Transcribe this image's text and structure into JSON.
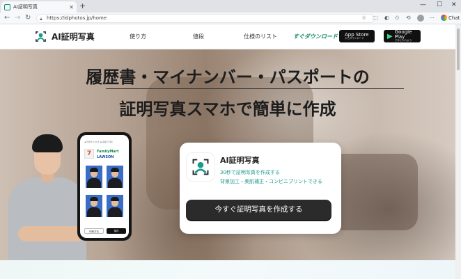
{
  "browser": {
    "tab_title": "AI証明写真",
    "tab_close": "✕",
    "new_tab": "+",
    "url": "https://idphotos.jp/home",
    "controls": {
      "minimize": "—",
      "maximize": "☐",
      "close": "✕"
    },
    "chat_label": "Chat"
  },
  "header": {
    "logo_text": "AI証明写真",
    "nav": [
      "使り方",
      "値段",
      "仕様のリスト"
    ],
    "download_link": "すぐダウンロード",
    "app_store": {
      "main": "App Store",
      "sub": "からダウンロード"
    },
    "google_play": {
      "main": "Google Play",
      "sub": "で手に入れよう"
    }
  },
  "hero": {
    "title_line1": "履歴書・マイナンバー・パスポートの",
    "title_line2": "証明写真スマホで簡単に作成"
  },
  "phone": {
    "top_text": "◀ 印刷する方法  ◀ 店舗で印刷",
    "seven": "7",
    "familymart": "FamilyMart",
    "lawson": "LAWSON",
    "btn_left": "印刷方法",
    "btn_right": "保存"
  },
  "card": {
    "app_title": "AI証明写真",
    "feature1": "30秒で証明写真を作成する",
    "feature2": "背景加工・美肌補正・コンビニプリントできる",
    "cta": "今すぐ証明写真を作成する"
  },
  "colors": {
    "accent": "#1a9a8c",
    "cta_bg": "#2b2b2b",
    "download_green": "#138a6a"
  }
}
